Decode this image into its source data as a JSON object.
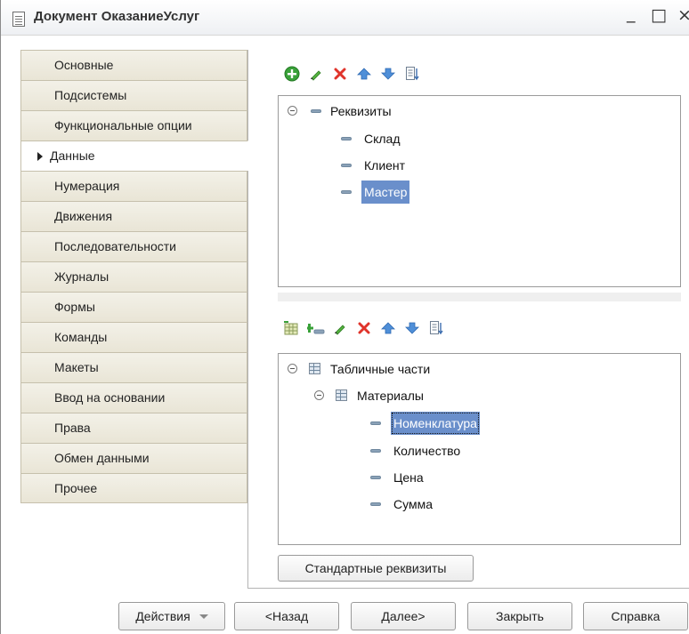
{
  "window": {
    "title": "Документ ОказаниеУслуг",
    "minimize": "_",
    "maximize": "□",
    "close": "×"
  },
  "tabs": [
    {
      "label": "Основные",
      "active": false
    },
    {
      "label": "Подсистемы",
      "active": false
    },
    {
      "label": "Функциональные опции",
      "active": false
    },
    {
      "label": "Данные",
      "active": true
    },
    {
      "label": "Нумерация",
      "active": false
    },
    {
      "label": "Движения",
      "active": false
    },
    {
      "label": "Последовательности",
      "active": false
    },
    {
      "label": "Журналы",
      "active": false
    },
    {
      "label": "Формы",
      "active": false
    },
    {
      "label": "Команды",
      "active": false
    },
    {
      "label": "Макеты",
      "active": false
    },
    {
      "label": "Ввод на основании",
      "active": false
    },
    {
      "label": "Права",
      "active": false
    },
    {
      "label": "Обмен данными",
      "active": false
    },
    {
      "label": "Прочее",
      "active": false
    }
  ],
  "attributes_toolbar": {
    "icons": [
      "add-icon",
      "edit-icon",
      "delete-icon",
      "move-up-icon",
      "move-down-icon",
      "sort-list-icon"
    ]
  },
  "attributes_tree": {
    "root": "Реквизиты",
    "items": [
      "Склад",
      "Клиент",
      "Мастер"
    ],
    "selected": "Мастер"
  },
  "tabular_toolbar": {
    "icons": [
      "add-table-icon",
      "add-column-icon",
      "edit-icon",
      "delete-icon",
      "move-up-icon",
      "move-down-icon",
      "sort-list-icon"
    ]
  },
  "tabular_tree": {
    "root": "Табличные части",
    "table": "Материалы",
    "items": [
      "Номенклатура",
      "Количество",
      "Цена",
      "Сумма"
    ],
    "selected": "Номенклатура"
  },
  "standard_attributes_button": "Стандартные реквизиты",
  "footer": {
    "actions": "Действия",
    "back": "<Назад",
    "next": "Далее>",
    "close": "Закрыть",
    "help": "Справка"
  },
  "colors": {
    "selection": "#6a8fcb",
    "add_green": "#3aa13a",
    "delete_red": "#e0342b",
    "arrow_blue": "#4f8fd8"
  }
}
